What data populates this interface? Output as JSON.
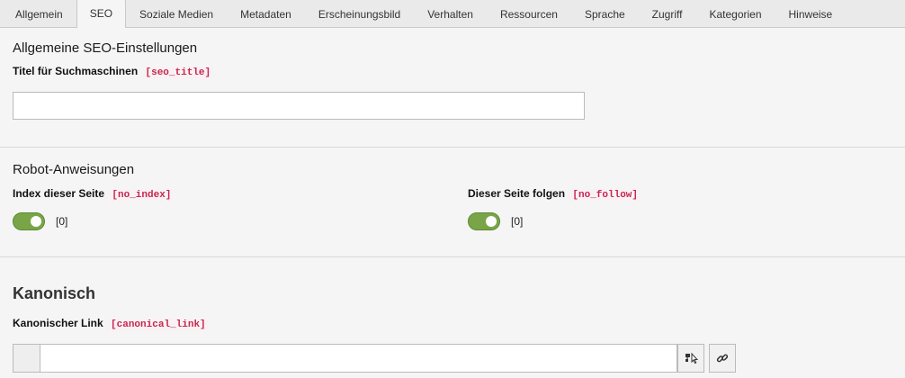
{
  "tabs": [
    {
      "label": "Allgemein"
    },
    {
      "label": "SEO",
      "active": true
    },
    {
      "label": "Soziale Medien"
    },
    {
      "label": "Metadaten"
    },
    {
      "label": "Erscheinungsbild"
    },
    {
      "label": "Verhalten"
    },
    {
      "label": "Ressourcen"
    },
    {
      "label": "Sprache"
    },
    {
      "label": "Zugriff"
    },
    {
      "label": "Kategorien"
    },
    {
      "label": "Hinweise"
    }
  ],
  "seo_settings": {
    "heading": "Allgemeine SEO-Einstellungen",
    "title_label": "Titel für Suchmaschinen",
    "title_field": "[seo_title]",
    "title_value": ""
  },
  "robots": {
    "heading": "Robot-Anweisungen",
    "index_label": "Index dieser Seite",
    "index_field": "[no_index]",
    "index_value": "[0]",
    "follow_label": "Dieser Seite folgen",
    "follow_field": "[no_follow]",
    "follow_value": "[0]"
  },
  "canonical": {
    "heading": "Kanonisch",
    "link_label": "Kanonischer Link",
    "link_field": "[canonical_link]",
    "link_value": ""
  },
  "colors": {
    "toggle_on": "#79a548",
    "code_text": "#c7254e"
  },
  "icons": {
    "page_browser": "page-tree-browse-icon",
    "link": "link-icon"
  }
}
